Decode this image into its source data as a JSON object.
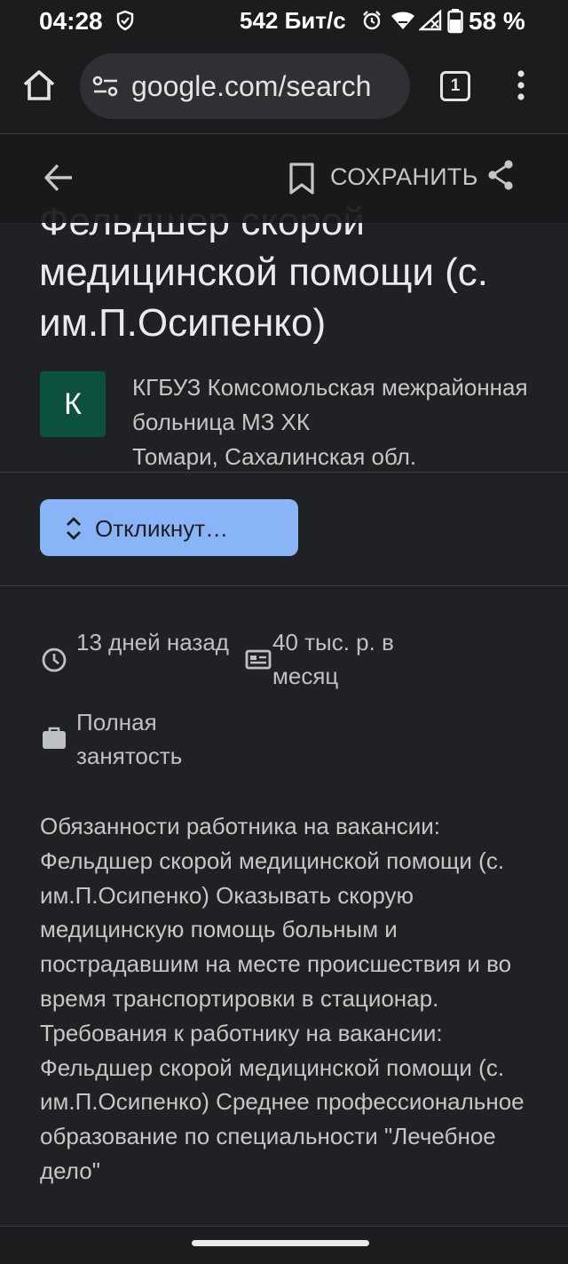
{
  "status_bar": {
    "time": "04:28",
    "network_speed": "542 Бит/с",
    "battery_percent": "58 %"
  },
  "browser": {
    "url": "google.com/search",
    "tab_count": "1"
  },
  "job": {
    "save_label": "СОХРАНИТЬ",
    "title": "Фельдшер скорой медицинской помощи (с. им.П.Осипенко)",
    "employer_initial": "К",
    "employer_name": "КГБУЗ Комсомольская межрайонная больница МЗ ХК",
    "location": "Томари, Сахалинская обл.",
    "apply_label": "Откликнут…",
    "posted": "13 дней назад",
    "salary": "40 тыс. р. в месяц",
    "employment_type": "Полная занятость",
    "description": "Обязанности работника на вакансии: Фельдшер скорой медицинской помощи (с. им.П.Осипенко) Оказывать скорую медицинскую помощь больным и пострадавшим на месте происшествия и во время транспортировки в стационар. Требования к работнику на вакансии: Фельдшер скорой медицинской помощи (с. им.П.Осипенко) Среднее профессиональное образование по специальности \"Лечебное дело\""
  },
  "colors": {
    "background": "#202124",
    "accent_button": "#8ab4f8",
    "logo_bg": "#0b513e"
  },
  "icons": [
    "shield-icon",
    "alarm-icon",
    "wifi-icon",
    "signal-icon",
    "battery-icon",
    "home-icon",
    "tune-icon",
    "tabs-icon",
    "menu-icon",
    "back-icon",
    "bookmark-icon",
    "share-icon",
    "chevron-updown-icon",
    "clock-icon",
    "salary-icon",
    "briefcase-icon"
  ]
}
